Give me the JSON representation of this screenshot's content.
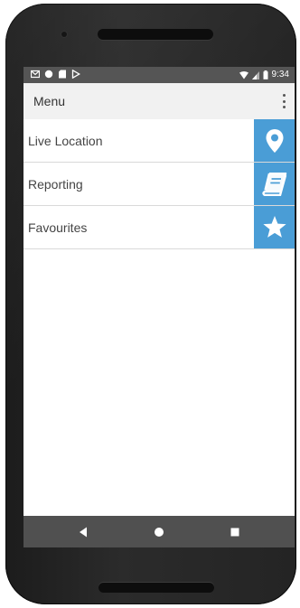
{
  "status_bar": {
    "time": "9:34",
    "left_icons": [
      "gmail-icon",
      "circle-app-icon",
      "sd-card-icon",
      "play-store-icon"
    ],
    "right_icons": [
      "wifi-icon",
      "signal-icon",
      "battery-icon"
    ]
  },
  "app_bar": {
    "title": "Menu",
    "overflow_icon": "more-vert-icon"
  },
  "menu": {
    "items": [
      {
        "label": "Live Location",
        "icon": "map-pin-icon"
      },
      {
        "label": "Reporting",
        "icon": "book-icon"
      },
      {
        "label": "Favourites",
        "icon": "star-icon"
      }
    ]
  },
  "nav_bar": {
    "buttons": [
      "back-icon",
      "home-icon",
      "recents-icon"
    ]
  },
  "colors": {
    "accent": "#4a9dd6",
    "status_bar": "#555555",
    "app_bar": "#f1f1f1",
    "nav_bar": "#505050"
  }
}
